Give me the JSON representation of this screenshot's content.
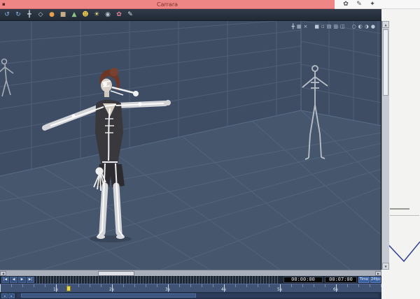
{
  "titlebar": {
    "title": "Carrara",
    "window_icon_glyph": "▪",
    "corner_icons": [
      {
        "name": "assemble-room-icon",
        "glyph": "✿"
      },
      {
        "name": "edit-pencil-icon",
        "glyph": "✎"
      },
      {
        "name": "render-room-icon",
        "glyph": "✦"
      }
    ]
  },
  "toolbar": {
    "icons": [
      {
        "name": "undo-icon",
        "glyph": "↺",
        "color": "#8fb7e8"
      },
      {
        "name": "redo-icon",
        "glyph": "↻",
        "color": "#8fb7e8"
      },
      {
        "name": "move-tool-icon",
        "glyph": "╋",
        "color": "#c9cdd4"
      },
      {
        "name": "scale-tool-icon",
        "glyph": "◇",
        "color": "#c9cdd4"
      },
      {
        "name": "sphere-primitive-icon",
        "glyph": "●",
        "color": "#e8a04a"
      },
      {
        "name": "cube-primitive-icon",
        "glyph": "■",
        "color": "#c8ae86"
      },
      {
        "name": "cone-primitive-icon",
        "glyph": "▲",
        "color": "#92c487"
      },
      {
        "name": "figure-icon",
        "glyph": "☻",
        "color": "#e6c64f"
      },
      {
        "name": "light-icon",
        "glyph": "☀",
        "color": "#efe18c"
      },
      {
        "name": "camera-icon",
        "glyph": "◉",
        "color": "#b9c2cf"
      },
      {
        "name": "shader-icon",
        "glyph": "✿",
        "color": "#dd8898"
      },
      {
        "name": "render-icon",
        "glyph": "✎",
        "color": "#d8dde4"
      }
    ]
  },
  "viewport": {
    "toolbar_icons": [
      {
        "name": "crosshair-icon",
        "glyph": "╋"
      },
      {
        "name": "grid-icon",
        "glyph": "▦"
      },
      {
        "name": "close-icon",
        "glyph": "×"
      },
      {
        "name": "solid-view-icon",
        "glyph": "■"
      },
      {
        "name": "wireframe-view-icon",
        "glyph": "▫"
      },
      {
        "name": "flat-shade-view-icon",
        "glyph": "▤"
      },
      {
        "name": "gouraud-view-icon",
        "glyph": "▥"
      },
      {
        "name": "split-view-icon",
        "glyph": "◫"
      },
      {
        "name": "sphere-outline-icon",
        "glyph": "○"
      },
      {
        "name": "sphere-half-icon",
        "glyph": "◐"
      },
      {
        "name": "sphere-half2-icon",
        "glyph": "◑"
      },
      {
        "name": "sphere-shaded-icon",
        "glyph": "●"
      }
    ]
  },
  "timeline": {
    "nav_buttons": [
      {
        "name": "go-start-button",
        "label": "|◀"
      },
      {
        "name": "step-back-button",
        "label": "◀"
      },
      {
        "name": "play-button",
        "label": "▶"
      },
      {
        "name": "go-end-button",
        "label": "▶|"
      }
    ],
    "current_time": "00:00:00",
    "end_time": "00:07:00",
    "time_mode_button": "Time",
    "fps_button": "24fps",
    "ruler_labels": [
      "1s",
      "2s",
      "3s",
      "4s",
      "5s",
      "6s"
    ],
    "mini_buttons": [
      {
        "name": "scroll-left-button",
        "label": "◂"
      },
      {
        "name": "scroll-right-button",
        "label": "▸"
      }
    ]
  },
  "colors": {
    "titlebar_pink": "#ed8684",
    "viewport_background": "#3e4d63",
    "floor": "#46566d",
    "grid_line": "#4e5f79",
    "accent_blue": "#3a5f9e",
    "playhead_yellow": "#ead94e"
  }
}
